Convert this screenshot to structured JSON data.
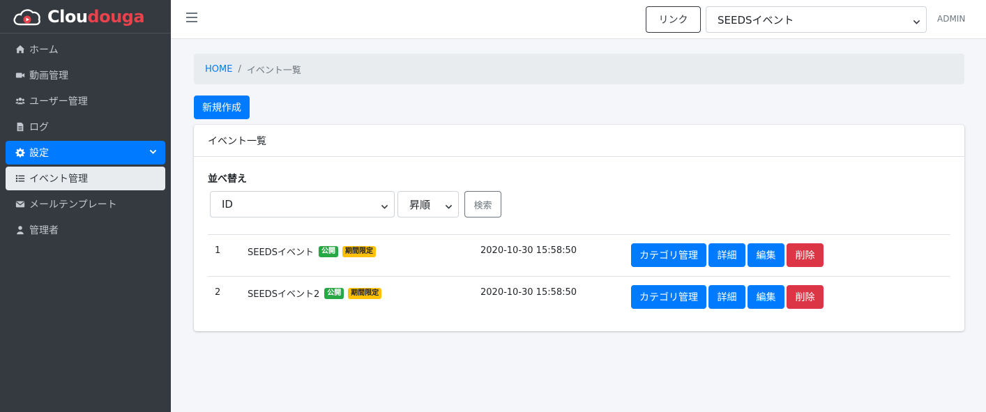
{
  "brand": {
    "part1": "Clou",
    "part2": "douga"
  },
  "sidebar": {
    "items": [
      {
        "label": "ホーム",
        "icon": "home-icon"
      },
      {
        "label": "動画管理",
        "icon": "video-icon"
      },
      {
        "label": "ユーザー管理",
        "icon": "users-icon"
      },
      {
        "label": "ログ",
        "icon": "file-icon"
      },
      {
        "label": "設定",
        "icon": "gear-icon"
      },
      {
        "label": "イベント管理",
        "icon": "list-icon"
      },
      {
        "label": "メールテンプレート",
        "icon": "envelope-icon"
      },
      {
        "label": "管理者",
        "icon": "user-icon"
      }
    ]
  },
  "topbar": {
    "link_label": "リンク",
    "event_selected": "SEEDSイベント",
    "user_label": "ADMIN"
  },
  "breadcrumb": {
    "home": "HOME",
    "separator": "/",
    "current": "イベント一覧"
  },
  "new_button": "新規作成",
  "card": {
    "title": "イベント一覧",
    "sort_label": "並べ替え",
    "sort_field": "ID",
    "sort_order": "昇順",
    "search_label": "検索"
  },
  "events": [
    {
      "id": "1",
      "name": "SEEDSイベント",
      "badge_public": "公開",
      "badge_limited": "期間限定",
      "date": "2020-10-30 15:58:50"
    },
    {
      "id": "2",
      "name": "SEEDSイベント2",
      "badge_public": "公開",
      "badge_limited": "期間限定",
      "date": "2020-10-30 15:58:50"
    }
  ],
  "row_actions": {
    "category": "カテゴリ管理",
    "detail": "詳細",
    "edit": "編集",
    "delete": "削除"
  },
  "colors": {
    "primary": "#007bff",
    "danger": "#dc3545",
    "success": "#28a745",
    "warning": "#ffc107",
    "sidebar": "#343a40",
    "brand_accent": "#e8424d"
  }
}
